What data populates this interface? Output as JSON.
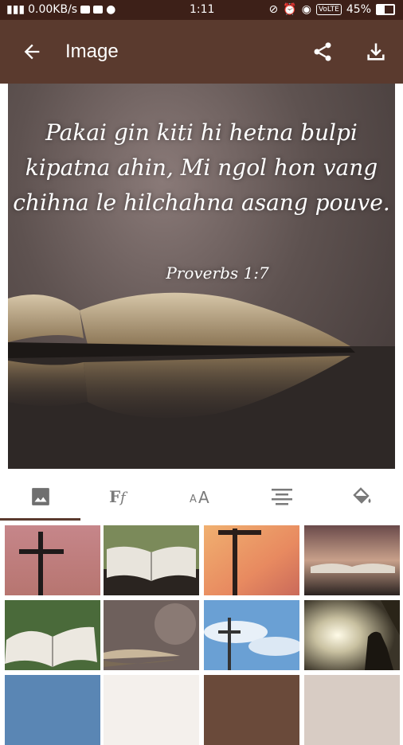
{
  "status_bar": {
    "network_speed": "0.00KB/s",
    "time": "1:11",
    "network_type": "VoLTE",
    "battery": "45%",
    "battery_level": 0.45
  },
  "app_bar": {
    "title": "Image",
    "back_icon": "arrow-back-icon",
    "share_icon": "share-icon",
    "download_icon": "download-icon"
  },
  "preview": {
    "quote": "Pakai gin kiti hi hetna bulpi kipatna ahin, Mi ngol hon vang chihna le hilchahna asang pouve.",
    "reference": "Proverbs 1:7"
  },
  "tabs": [
    {
      "name": "image",
      "icon": "image-icon"
    },
    {
      "name": "font",
      "icon": "font-icon"
    },
    {
      "name": "text-size",
      "icon": "text-size-icon"
    },
    {
      "name": "alignment",
      "icon": "align-center-icon"
    },
    {
      "name": "color",
      "icon": "paint-bucket-icon"
    }
  ],
  "colors": {
    "app_bar": "#5a3a2e",
    "status_bar": "#3d2018",
    "tab_indicator": "#5a3a2e",
    "tab_icon": "#7a7a7a"
  }
}
